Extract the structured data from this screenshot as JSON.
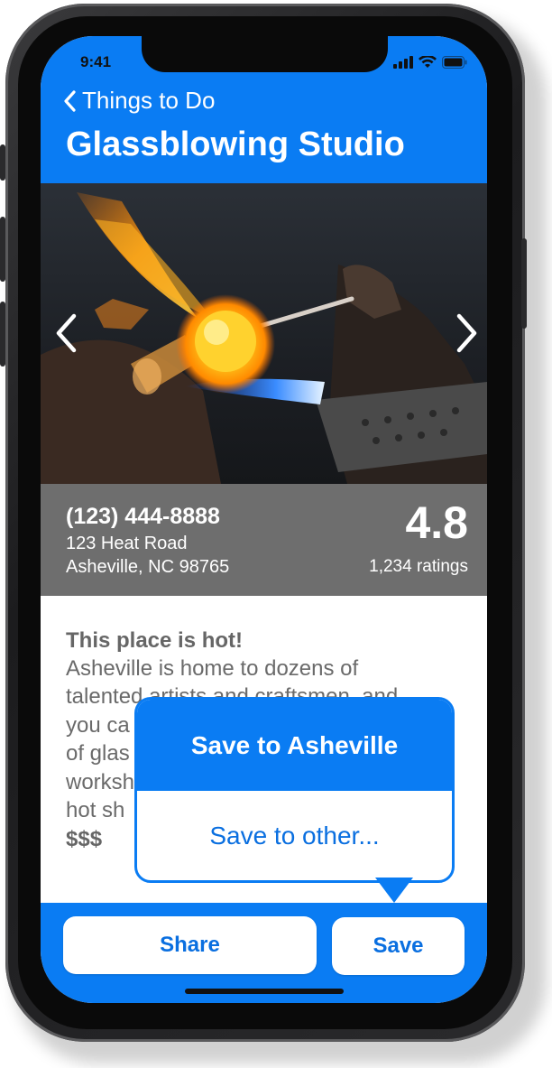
{
  "status": {
    "time": "9:41"
  },
  "nav": {
    "back_label": "Things to Do"
  },
  "page": {
    "title": "Glassblowing Studio"
  },
  "contact": {
    "phone": "(123) 444-8888",
    "address_line1": "123 Heat Road",
    "address_line2": "Asheville, NC 98765",
    "rating": "4.8",
    "ratings_count": "1,234 ratings"
  },
  "description": {
    "heading": "This place is hot!",
    "lines": [
      "Asheville is home to dozens of",
      "talented artists and craftsmen, and",
      "you ca",
      "of glas",
      "worksh",
      "hot sh"
    ],
    "price": "$$$"
  },
  "popover": {
    "primary_label": "Save to Asheville",
    "secondary_label": "Save to other..."
  },
  "footer": {
    "share_label": "Share",
    "save_label": "Save"
  },
  "colors": {
    "accent": "#0a7cf3",
    "info_band": "#6e6e6e",
    "button_text": "#0a6fe0"
  },
  "icons": {
    "back": "chevron-left-icon",
    "photo_prev": "chevron-left-icon",
    "photo_next": "chevron-right-icon",
    "signal": "cellular-signal-icon",
    "wifi": "wifi-icon",
    "battery": "battery-icon"
  }
}
